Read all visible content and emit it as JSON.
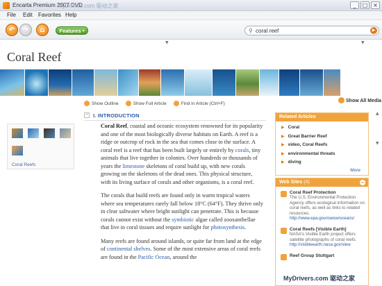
{
  "window": {
    "title": "Encarta Premium 2007 DVD",
    "watermark_top": "MyDrivers.com 驱动之家",
    "minimize": "_",
    "maximize": "□",
    "close": "×"
  },
  "menu": [
    "File",
    "Edit",
    "Favorites",
    "Help"
  ],
  "toolbar": {
    "back_icon": "back-arrow-icon",
    "forward_icon": "forward-arrow-icon",
    "home_icon": "home-icon",
    "features_label": "Features",
    "search_value": "coral reef",
    "back_glyph": "↶",
    "forward_glyph": "↷",
    "home_glyph": "⌂",
    "features_glyph": "▾",
    "search_glyph": "⚲",
    "go_glyph": "▶"
  },
  "article": {
    "title": "Coral Reef",
    "show_all_media": "Show All Media",
    "tools": {
      "outline": "Show Outline",
      "full": "Show Full Article",
      "find": "Find in Article (Ctrl+F)"
    },
    "media_caption": "Coral Reefs",
    "section": {
      "toggle": "−",
      "heading": "I. INTRODUCTION"
    },
    "paragraphs": {
      "p1_term": "Coral Reef",
      "p1_a": ", coastal and oceanic ecosystem renowned for its popularity and one of the most biologically diverse habitats on Earth. A reef is a ridge or outcrop of rock in the sea that comes close to the surface. A coral reef is a reef that has been built largely or entirely by ",
      "p1_link1": "corals",
      "p1_b": ", tiny animals that live together in colonies. Over hundreds or thousands of years the ",
      "p1_link2": "limestone",
      "p1_c": " skeletons of coral build up, with new corals growing on the skeletons of the dead ones. This physical structure, with its living surface of corals and other organisms, is a coral reef.",
      "p2_a": "The corals that build reefs are found only in warm tropical waters where sea temperatures rarely fall below 18°C (64°F). They thrive only in clear saltwater where bright sunlight can penetrate. This is because corals cannot exist without the ",
      "p2_link1": "symbiotic",
      "p2_b": " algae called zooxanthellae that live in coral tissues and require sunlight for ",
      "p2_link2": "photosynthesis",
      "p2_c": ".",
      "p3_a": "Many reefs are found around islands, or quite far from land at the edge of ",
      "p3_link1": "continental shelves",
      "p3_b": ". Some of the most extensive areas of coral reefs are found in the ",
      "p3_link2": "Pacific Ocean",
      "p3_c": ", around the"
    }
  },
  "related": {
    "title": "Related Articles",
    "items": [
      "Coral",
      "Great Barrier Reef",
      "video, Coral Reefs",
      "environmental threats",
      "diving"
    ],
    "more": "More"
  },
  "websites": {
    "title": "Web Sites",
    "count": "(4)",
    "collapse_glyph": "−",
    "items": [
      {
        "name": "Coral Reef Protection",
        "desc": "The U.S. Environmental Protection Agency offers ecological information on coral reefs, as well as links to related resources.",
        "url": "http://www.epa.gov/owow/oceans/"
      },
      {
        "name": "Coral Reefs [Visible Earth]",
        "desc": "NASA's Visible Earth project offers satellite photographs of coral reefs.",
        "url": "http://visibleearth.nasa.gov/view"
      },
      {
        "name": "Reef Group Stuttgart",
        "desc": "",
        "url": ""
      }
    ]
  },
  "bottom_watermark": "MyDrivers.com 驱动之家",
  "colors": {
    "accent_orange": "#f0a33c",
    "link_blue": "#2a5aa6",
    "features_green": "#4e9b26"
  }
}
